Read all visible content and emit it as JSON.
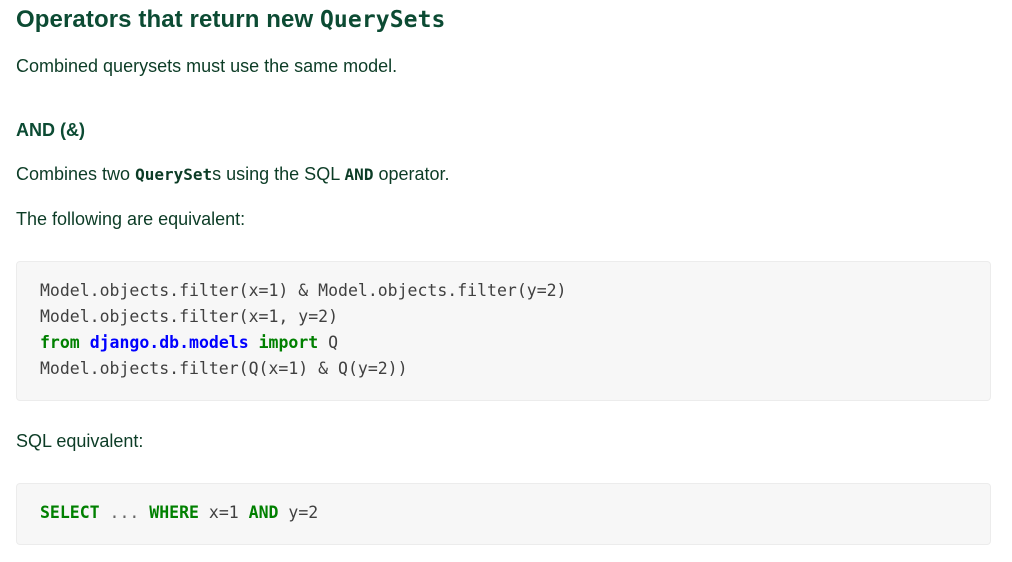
{
  "heading": {
    "text": "Operators that return new ",
    "code": "QuerySets"
  },
  "intro": "Combined querysets must use the same model.",
  "subheading": "AND (&)",
  "description": {
    "pre": "Combines two ",
    "code1": "QuerySet",
    "mid1": "s using the SQL ",
    "code2": "AND",
    "post": " operator."
  },
  "equivalent_text": "The following are equivalent:",
  "python_code": {
    "line1": "Model.objects.filter(x=1) & Model.objects.filter(y=2)",
    "line2": "Model.objects.filter(x=1, y=2)",
    "line3_kw1": "from",
    "line3_mod": "django.db.models",
    "line3_kw2": "import",
    "line3_name": "Q",
    "line4": "Model.objects.filter(Q(x=1) & Q(y=2))"
  },
  "sql_label": "SQL equivalent:",
  "sql_code": {
    "kw1": "SELECT",
    "ellipsis": "...",
    "kw2": "WHERE",
    "cond1": "x=1",
    "kw3": "AND",
    "cond2": "y=2"
  }
}
